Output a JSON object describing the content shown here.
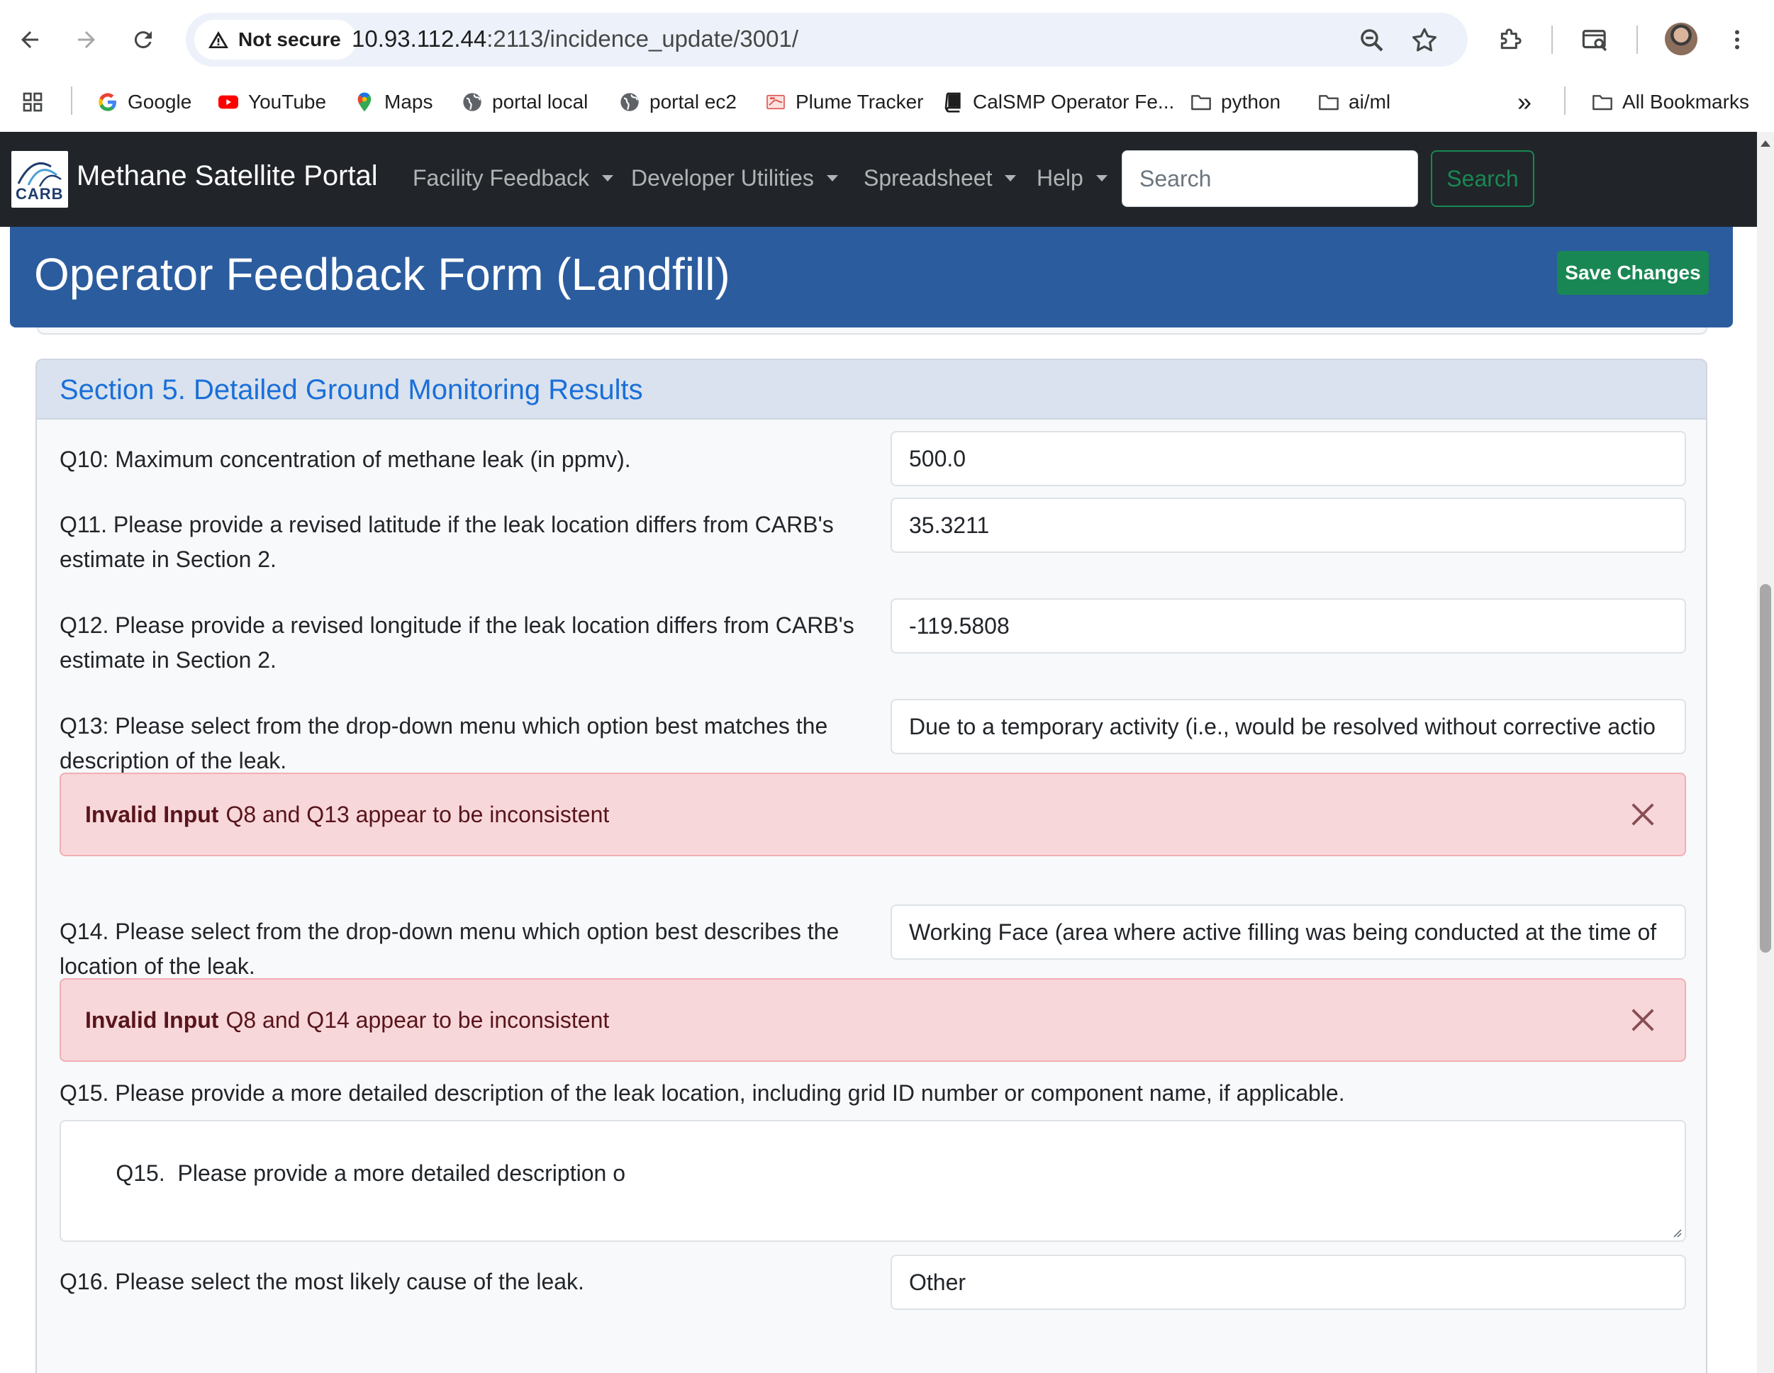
{
  "browser": {
    "security_label": "Not secure",
    "url_host": "10.93.112.44",
    "url_rest": ":2113/incidence_update/3001/",
    "bookmarks": [
      {
        "label": "Google",
        "icon": "google-icon"
      },
      {
        "label": "YouTube",
        "icon": "youtube-icon"
      },
      {
        "label": "Maps",
        "icon": "maps-icon"
      },
      {
        "label": "portal local",
        "icon": "globe-icon"
      },
      {
        "label": "portal ec2",
        "icon": "globe-icon"
      },
      {
        "label": "Plume Tracker",
        "icon": "plume-icon"
      },
      {
        "label": "CalSMP Operator Fe...",
        "icon": "book-icon"
      },
      {
        "label": "python",
        "icon": "folder-icon"
      },
      {
        "label": "ai/ml",
        "icon": "folder-icon"
      }
    ],
    "overflow_label": "»",
    "all_bookmarks_label": "All Bookmarks"
  },
  "navbar": {
    "logo_text": "CARB",
    "brand": "Methane Satellite Portal",
    "items": [
      {
        "label": "Facility Feedback"
      },
      {
        "label": "Developer Utilities"
      },
      {
        "label": "Spreadsheet"
      },
      {
        "label": "Help"
      }
    ],
    "search_placeholder": "Search",
    "search_button": "Search"
  },
  "form": {
    "title": "Operator Feedback Form (Landfill)",
    "save_label": "Save Changes",
    "section_title": "Section 5. Detailed Ground Monitoring Results",
    "q10": {
      "label": "Q10: Maximum concentration of methane leak (in ppmv).",
      "value": "500.0"
    },
    "q11": {
      "label": "Q11. Please provide a revised latitude if the leak location differs from CARB's estimate in Section 2.",
      "value": "35.3211"
    },
    "q12": {
      "label": "Q12. Please provide a revised longitude if the leak location differs from CARB's estimate in Section 2.",
      "value": "-119.5808"
    },
    "q13": {
      "label": "Q13: Please select from the drop-down menu which option best matches the description of the leak.",
      "value": "Due to a temporary activity (i.e., would be resolved without corrective actio"
    },
    "alert1": {
      "strong": "Invalid Input",
      "text": "Q8 and Q13 appear to be inconsistent"
    },
    "q14": {
      "label": "Q14. Please select from the drop-down menu which option best describes the location of the leak.",
      "value": "Working Face (area where active filling was being conducted at the time of"
    },
    "alert2": {
      "strong": "Invalid Input",
      "text": "Q8 and Q14 appear to be inconsistent"
    },
    "q15": {
      "label": "Q15. Please provide a more detailed description of the leak location, including grid ID number or component name, if applicable.",
      "value": "Q15.  Please provide a more detailed description o"
    },
    "q16": {
      "label": "Q16. Please select the most likely cause of the leak.",
      "value": "Other"
    }
  },
  "colors": {
    "navbar_bg": "#212529",
    "header_blue": "#2b5c9e",
    "section_title": "#1a6fd8",
    "save_green": "#198754",
    "alert_bg": "#f8d7da",
    "alert_text": "#58151c"
  }
}
